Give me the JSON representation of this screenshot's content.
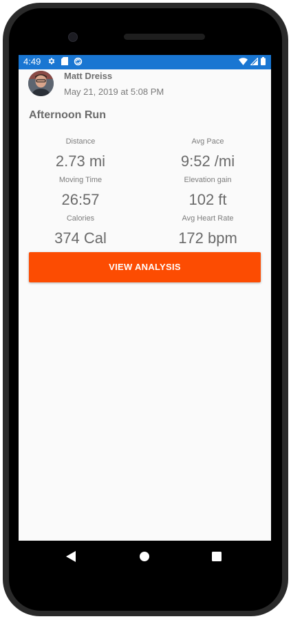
{
  "status_bar": {
    "time": "4:49",
    "left_icons": [
      "gear-icon",
      "sd-card-icon",
      "sync-icon"
    ],
    "right_icons": [
      "wifi-icon",
      "cell-signal-icon",
      "battery-icon"
    ],
    "color": "#1976d2"
  },
  "activity": {
    "athlete_name": "Matt Dreiss",
    "date": "May 21, 2019 at 5:08 PM",
    "title": "Afternoon Run"
  },
  "stats": [
    {
      "label": "Distance",
      "value": "2.73 mi"
    },
    {
      "label": "Avg Pace",
      "value": "9:52 /mi"
    },
    {
      "label": "Moving Time",
      "value": "26:57"
    },
    {
      "label": "Elevation gain",
      "value": "102 ft"
    },
    {
      "label": "Calories",
      "value": "374 Cal"
    },
    {
      "label": "Avg Heart Rate",
      "value": "172 bpm"
    }
  ],
  "actions": {
    "view_analysis_label": "VIEW ANALYSIS",
    "accent_color": "#fc4c02"
  },
  "nav_bar": {
    "icons": [
      "back-icon",
      "home-icon",
      "recents-icon"
    ]
  }
}
